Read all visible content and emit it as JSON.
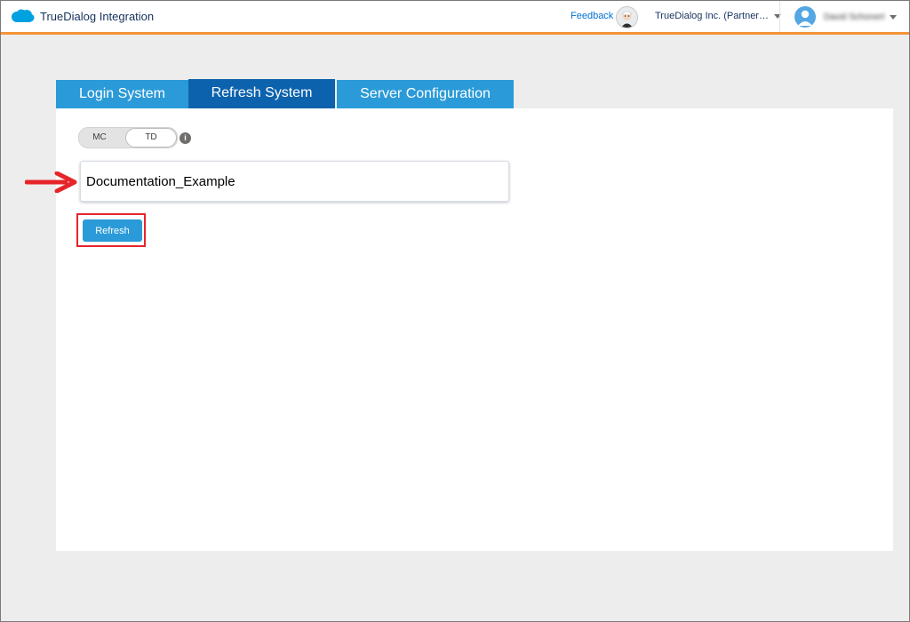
{
  "header": {
    "app_title": "TrueDialog Integration",
    "feedback_label": "Feedback",
    "org_name": "TrueDialog Inc. (Partner…",
    "user_name": "David Schonert"
  },
  "tabs": [
    {
      "label": "Login System",
      "active": false
    },
    {
      "label": "Refresh System",
      "active": true
    },
    {
      "label": "Server Configuration",
      "active": false
    }
  ],
  "mode_toggle": {
    "options": [
      "MC",
      "TD"
    ],
    "selected": "TD"
  },
  "system_field": {
    "value": "Documentation_Example"
  },
  "refresh_button_label": "Refresh",
  "colors": {
    "header_accent": "#f49338",
    "tab": "#2a9ad8",
    "tab_active": "#0c62ad",
    "highlight": "#e5252a"
  }
}
